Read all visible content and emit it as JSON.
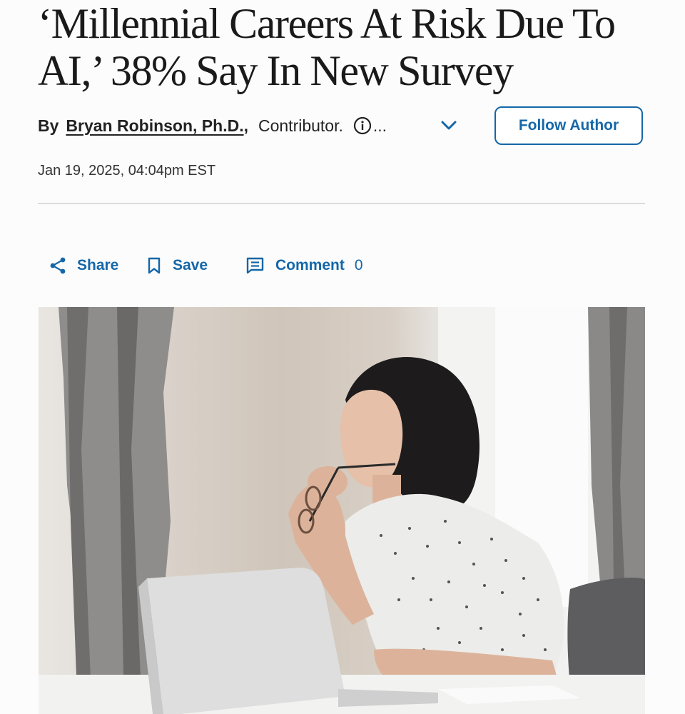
{
  "article": {
    "headline": "‘Millennial Careers At Risk Due To AI,’ 38% Say In New Survey",
    "byline": {
      "by": "By",
      "author": "Bryan Robinson, Ph.D.",
      "comma": ",",
      "role": "Contributor.",
      "ellipsis": "..."
    },
    "follow_label": "Follow Author",
    "date": "Jan 19, 2025, 04:04pm EST"
  },
  "actions": {
    "share_label": "Share",
    "save_label": "Save",
    "comment_label": "Comment",
    "comment_count": "0"
  },
  "icons": {
    "info": "info-icon",
    "chevron": "chevron-down-icon",
    "share": "share-icon",
    "save": "bookmark-icon",
    "comment": "comment-icon"
  },
  "colors": {
    "accent": "#1567a8",
    "text": "#1f1f1f",
    "divider": "#dcdcdc",
    "background": "#fcfcfc"
  }
}
